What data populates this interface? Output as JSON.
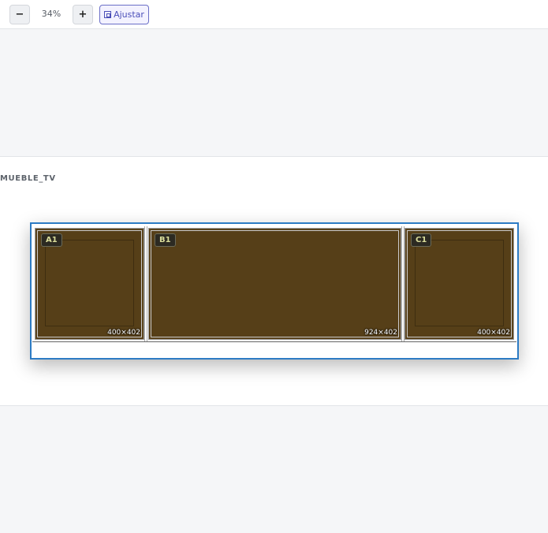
{
  "toolbar": {
    "zoom_out_label": "−",
    "zoom_level": "34%",
    "zoom_in_label": "+",
    "fit_label": "Ajustar",
    "fit_icon": "fit-frame-icon"
  },
  "stage": {
    "label": "MUEBLE_TV"
  },
  "modules": [
    {
      "id": "A1",
      "dims": "400×402"
    },
    {
      "id": "B1",
      "dims": "924×402"
    },
    {
      "id": "C1",
      "dims": "400×402"
    }
  ],
  "colors": {
    "accent": "#2c7bc4",
    "wood": "#563f18",
    "fit_button": "#4b4fb8"
  }
}
